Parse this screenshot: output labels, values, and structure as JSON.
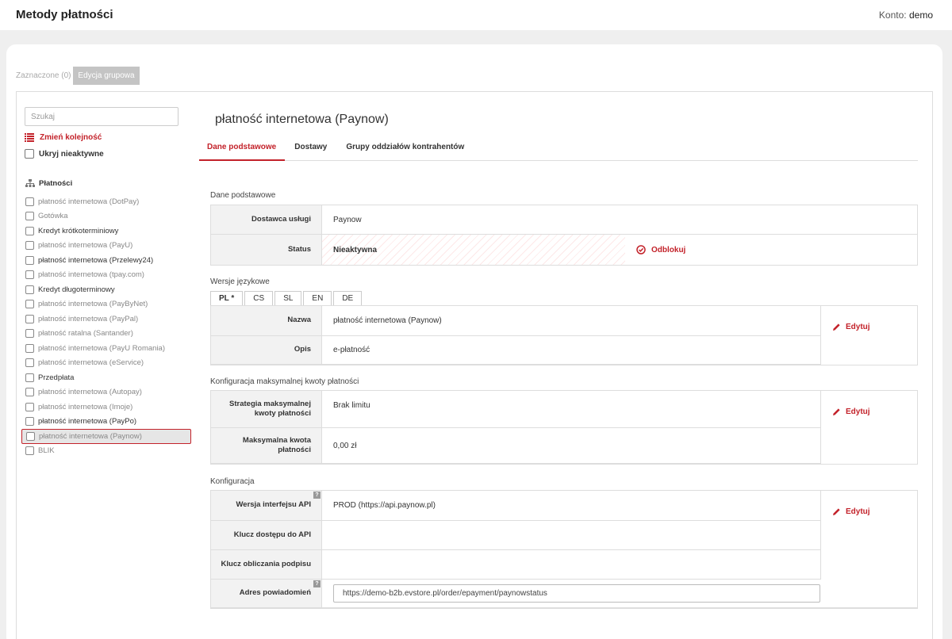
{
  "header": {
    "title": "Metody płatności",
    "account_label": "Konto:",
    "account_value": "demo"
  },
  "toolbar": {
    "selected": "Zaznaczone (0)",
    "group_edit": "Edycja grupowa"
  },
  "sidebar": {
    "search_placeholder": "Szukaj",
    "reorder": "Zmień kolejność",
    "hide_inactive": "Ukryj nieaktywne",
    "root": "Płatności",
    "items": [
      {
        "label": "płatność internetowa (DotPay)",
        "active": false
      },
      {
        "label": "Gotówka",
        "active": false
      },
      {
        "label": "Kredyt krótkoterminiowy",
        "active": true
      },
      {
        "label": "płatność internetowa (PayU)",
        "active": false
      },
      {
        "label": "płatność internetowa (Przelewy24)",
        "active": true
      },
      {
        "label": "płatność internetowa (tpay.com)",
        "active": false
      },
      {
        "label": "Kredyt długoterminowy",
        "active": true
      },
      {
        "label": "płatność internetowa (PayByNet)",
        "active": false
      },
      {
        "label": "płatność internetowa (PayPal)",
        "active": false
      },
      {
        "label": "płatność ratalna (Santander)",
        "active": false
      },
      {
        "label": "płatność internetowa (PayU Romania)",
        "active": false
      },
      {
        "label": "płatność internetowa (eService)",
        "active": false
      },
      {
        "label": "Przedpłata",
        "active": true
      },
      {
        "label": "płatność internetowa (Autopay)",
        "active": false
      },
      {
        "label": "płatność internetowa (Imoje)",
        "active": false
      },
      {
        "label": "płatność internetowa (PayPo)",
        "active": true
      },
      {
        "label": "płatność internetowa (Paynow)",
        "active": false,
        "selected": true
      },
      {
        "label": "BLIK",
        "active": false
      }
    ]
  },
  "detail": {
    "title": "płatność internetowa (Paynow)",
    "tabs": [
      "Dane podstawowe",
      "Dostawy",
      "Grupy oddziałów kontrahentów"
    ],
    "basic": {
      "section": "Dane podstawowe",
      "provider_label": "Dostawca usługi",
      "provider_value": "Paynow",
      "status_label": "Status",
      "status_value": "Nieaktywna",
      "unlock": "Odblokuj"
    },
    "lang": {
      "section": "Wersje językowe",
      "tabs": [
        "PL *",
        "CS",
        "SL",
        "EN",
        "DE"
      ],
      "name_label": "Nazwa",
      "name_value": "płatność internetowa (Paynow)",
      "desc_label": "Opis",
      "desc_value": "e-płatność"
    },
    "limit": {
      "section": "Konfiguracja maksymalnej kwoty płatności",
      "strategy_label_1": "Strategia maksymalnej",
      "strategy_label_2": "kwoty płatności",
      "strategy_value": "Brak limitu",
      "max_label_1": "Maksymalna kwota",
      "max_label_2": "płatności",
      "max_value": "0,00 zł"
    },
    "config": {
      "section": "Konfiguracja",
      "api_label": "Wersja interfejsu API",
      "api_value": "PROD (https://api.paynow.pl)",
      "key_label": "Klucz dostępu do API",
      "sig_label": "Klucz obliczania podpisu",
      "notify_label": "Adres powiadomień",
      "notify_value": "https://demo-b2b.evstore.pl/order/epayment/paynowstatus",
      "help": "?"
    },
    "edit": "Edytuj"
  }
}
